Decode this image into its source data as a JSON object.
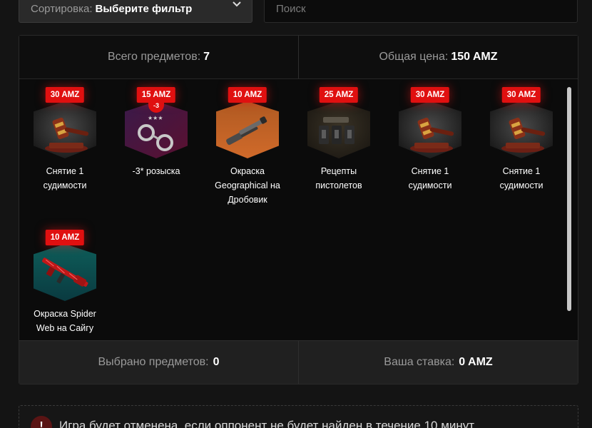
{
  "filters": {
    "sort_label": "Сортировка:",
    "sort_value": "Выберите фильтр",
    "search_placeholder": "Поиск"
  },
  "summary": {
    "total_items_label": "Всего предметов:",
    "total_items_value": "7",
    "total_price_label": "Общая цена:",
    "total_price_value": "150 AMZ"
  },
  "items": [
    {
      "price": "30 AMZ",
      "name_line1": "Снятие 1",
      "name_line2": "судимости",
      "name_line3": "",
      "icon": "gavel-icon"
    },
    {
      "price": "15 AMZ",
      "name_line1": "-3* розыска",
      "name_line2": "",
      "name_line3": "",
      "icon": "handcuffs-icon",
      "badge": "-3",
      "stars": "★★★"
    },
    {
      "price": "10 AMZ",
      "name_line1": "Окраска",
      "name_line2": "Geographical на",
      "name_line3": "Дробовик",
      "icon": "shotgun-icon"
    },
    {
      "price": "25 AMZ",
      "name_line1": "Рецепты",
      "name_line2": "пистолетов",
      "name_line3": "",
      "icon": "pistols-icon"
    },
    {
      "price": "30 AMZ",
      "name_line1": "Снятие 1",
      "name_line2": "судимости",
      "name_line3": "",
      "icon": "gavel-icon"
    },
    {
      "price": "30 AMZ",
      "name_line1": "Снятие 1",
      "name_line2": "судимости",
      "name_line3": "",
      "icon": "gavel-icon"
    },
    {
      "price": "10 AMZ",
      "name_line1": "Окраска Spider",
      "name_line2": "Web на Сайгу",
      "name_line3": "",
      "icon": "rifle-icon"
    }
  ],
  "selection": {
    "selected_label": "Выбрано предметов:",
    "selected_value": "0",
    "bet_label": "Ваша ставка:",
    "bet_value": "0 AMZ"
  },
  "notice": {
    "icon": "!",
    "text": "Игра будет отменена, если оппонент не будет найден в течение 10 минут"
  },
  "colors": {
    "price_badge": "#e01010",
    "accent": "#ffffff"
  }
}
